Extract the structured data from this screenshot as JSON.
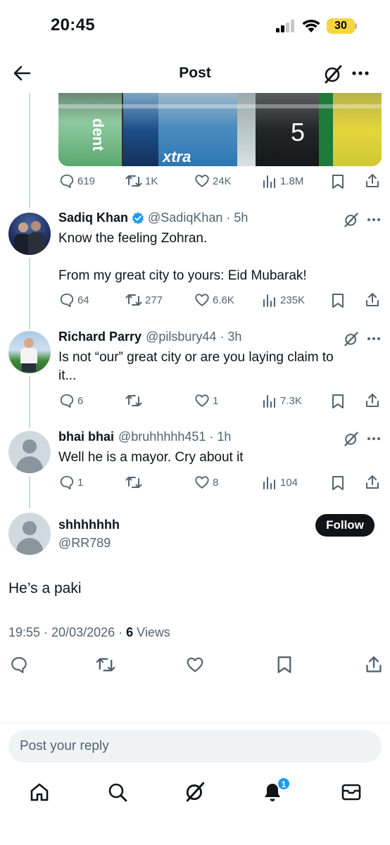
{
  "status_bar": {
    "time": "20:45",
    "battery": "30"
  },
  "header": {
    "title": "Post"
  },
  "top_post_actions": {
    "replies": "619",
    "reposts": "1K",
    "likes": "24K",
    "views": "1.8M"
  },
  "replies": [
    {
      "name": "Sadiq Khan",
      "handle": "@SadiqKhan",
      "time": "5h",
      "verified": true,
      "text_line1": "Know the feeling Zohran.",
      "text_line2": "From my great city to yours: Eid Mubarak!",
      "replies": "64",
      "reposts": "277",
      "likes": "6.6K",
      "views": "235K"
    },
    {
      "name": "Richard Parry",
      "handle": "@pilsbury44",
      "time": "3h",
      "text_line1": "Is not “our” great city or are you laying claim to",
      "text_line2": "it...",
      "replies": "6",
      "reposts": "",
      "likes": "1",
      "views": "7.3K"
    },
    {
      "name": "bhai bhai",
      "handle": "@bruhhhhh451",
      "time": "1h",
      "text_line1": "Well he is a mayor. Cry about it",
      "replies": "1",
      "reposts": "",
      "likes": "8",
      "views": "104"
    }
  ],
  "main_post": {
    "name": "shhhhhhh",
    "handle": "@RR789",
    "follow_label": "Follow",
    "text": "He’s a paki",
    "timestamp": "19:55 · 20/03/2026 · ",
    "views_count": "6",
    "views_label": " Views"
  },
  "reply_input": {
    "placeholder": "Post your reply"
  },
  "nav": {
    "notifications_badge": "1"
  },
  "colors": {
    "accent": "#1d9bf0",
    "text": "#0f1419",
    "muted": "#536471",
    "battery": "#f5d53c"
  },
  "icons": [
    "back-arrow-icon",
    "grok-icon",
    "more-icon",
    "reply-icon",
    "repost-icon",
    "like-icon",
    "views-icon",
    "bookmark-icon",
    "share-icon",
    "verified-icon",
    "home-icon",
    "search-icon",
    "bell-icon",
    "mail-icon"
  ]
}
